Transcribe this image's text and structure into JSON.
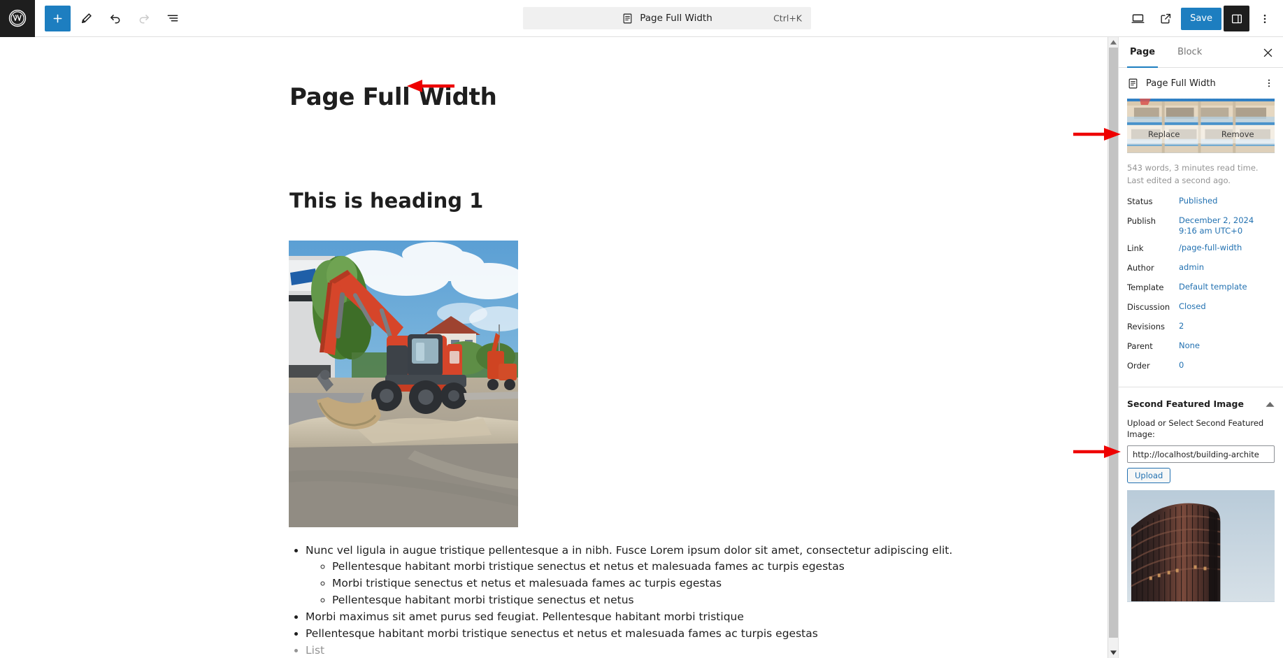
{
  "topbar": {
    "logo_icon": "wordpress-logo-icon",
    "tools": [
      {
        "name": "add-block-button",
        "icon": "plus-icon",
        "label": "Add block",
        "primary": true,
        "disabled": false
      },
      {
        "name": "edit-tool-button",
        "icon": "pencil-icon",
        "label": "Tools",
        "primary": false,
        "disabled": false
      },
      {
        "name": "undo-button",
        "icon": "undo-arrow-icon",
        "label": "Undo",
        "primary": false,
        "disabled": false
      },
      {
        "name": "redo-button",
        "icon": "redo-arrow-icon",
        "label": "Redo",
        "primary": false,
        "disabled": true
      },
      {
        "name": "document-overview-button",
        "icon": "list-view-icon",
        "label": "Document Overview",
        "primary": false,
        "disabled": false
      }
    ],
    "document_bar": {
      "icon": "page-document-icon",
      "title": "Page Full Width",
      "shortcut": "Ctrl+K"
    },
    "right_tools": [
      {
        "name": "view-device-button",
        "icon": "desktop-icon",
        "label": "View"
      },
      {
        "name": "view-page-button",
        "icon": "external-link-icon",
        "label": "View Page"
      }
    ],
    "save_label": "Save",
    "settings_icon": "sidebar-panel-icon",
    "options_icon": "kebab-menu-icon"
  },
  "editor": {
    "post_title": "Page Full Width",
    "heading": "This is heading 1",
    "image_alt": "red-excavator-construction-site",
    "list": [
      {
        "text": "Nunc vel ligula in augue tristique pellentesque a in nibh. Fusce Lorem ipsum dolor sit amet, consectetur adipiscing elit.",
        "placeholder": false,
        "children": [
          {
            "text": "Pellentesque habitant morbi tristique senectus et netus et malesuada fames ac turpis egestas",
            "placeholder": false
          },
          {
            "text": "Morbi tristique senectus et netus et malesuada fames ac turpis egestas",
            "placeholder": false
          },
          {
            "text": "Pellentesque habitant morbi tristique senectus et netus",
            "placeholder": false
          }
        ]
      },
      {
        "text": "Morbi maximus sit amet purus sed feugiat. Pellentesque habitant morbi tristique",
        "placeholder": false,
        "children": []
      },
      {
        "text": "Pellentesque habitant morbi tristique senectus et netus et malesuada fames ac turpis egestas",
        "placeholder": false,
        "children": []
      },
      {
        "text": "List",
        "placeholder": true,
        "children": []
      }
    ]
  },
  "sidebar": {
    "tabs": [
      {
        "label": "Page",
        "active": true,
        "name": "tab-page"
      },
      {
        "label": "Block",
        "active": false,
        "name": "tab-block"
      }
    ],
    "close_icon": "close-icon",
    "document": {
      "icon": "page-document-icon",
      "name": "Page Full Width",
      "kebab_icon": "kebab-menu-icon"
    },
    "featured_image": {
      "alt": "building-balconies-facade",
      "replace_label": "Replace",
      "remove_label": "Remove"
    },
    "stats": {
      "words": "543 words, 3 minutes read time.",
      "last_edited": "Last edited a second ago."
    },
    "rows": [
      {
        "label": "Status",
        "value": "Published",
        "name": "status-row"
      },
      {
        "label": "Publish",
        "value": "December 2, 2024 9:16 am UTC+0",
        "name": "publish-row"
      },
      {
        "label": "Link",
        "value": "/page-full-width",
        "name": "link-row"
      },
      {
        "label": "Author",
        "value": "admin",
        "name": "author-row"
      },
      {
        "label": "Template",
        "value": "Default template",
        "name": "template-row"
      },
      {
        "label": "Discussion",
        "value": "Closed",
        "name": "discussion-row"
      },
      {
        "label": "Revisions",
        "value": "2",
        "name": "revisions-row"
      },
      {
        "label": "Parent",
        "value": "None",
        "name": "parent-row"
      },
      {
        "label": "Order",
        "value": "0",
        "name": "order-row"
      }
    ],
    "second_featured_panel": {
      "title": "Second Featured Image",
      "toggle_icon": "chevron-up-icon",
      "field_label": "Upload or Select Second Featured Image:",
      "field_value": "http://localhost/building-archite",
      "upload_label": "Upload",
      "preview_alt": "dark-curved-glass-skyscraper"
    }
  },
  "colors": {
    "accent": "#1d7ec0",
    "link": "#2271b1",
    "annotation": "#ee0000",
    "dark": "#1e1e1e",
    "muted": "#949494"
  },
  "annotations": [
    {
      "name": "arrow-to-post-title",
      "target": "post title"
    },
    {
      "name": "arrow-to-featured-image",
      "target": "featured image"
    },
    {
      "name": "arrow-to-second-featured-panel",
      "target": "Second Featured Image panel"
    }
  ]
}
